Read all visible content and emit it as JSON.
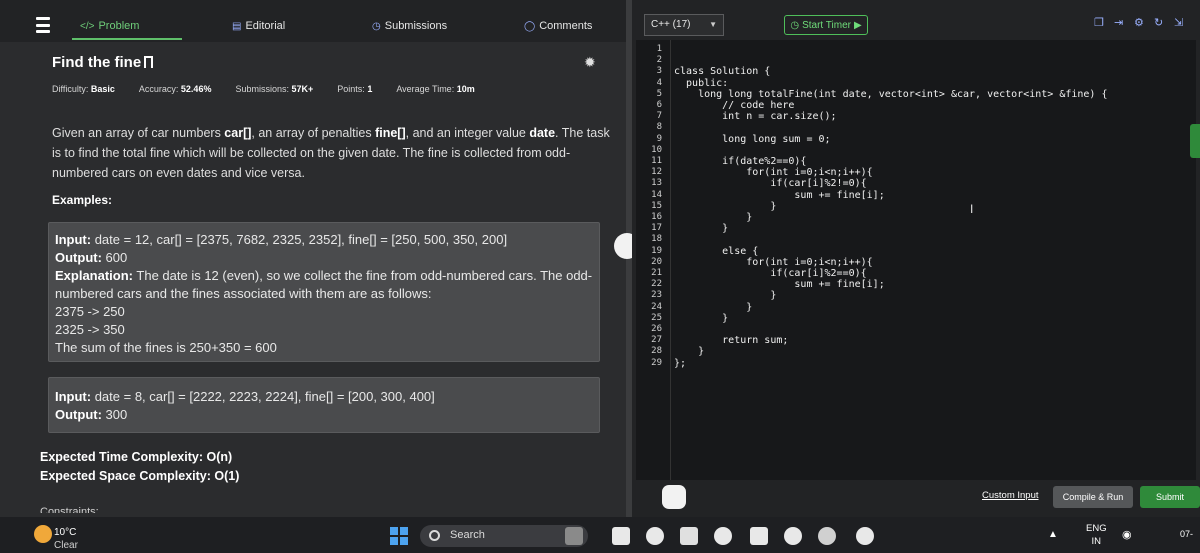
{
  "tabs": {
    "problem": "Problem",
    "editorial": "Editorial",
    "submissions": "Submissions",
    "comments": "Comments"
  },
  "problem": {
    "title": "Find the fine",
    "meta": {
      "difficulty_label": "Difficulty:",
      "difficulty": "Basic",
      "accuracy_label": "Accuracy:",
      "accuracy": "52.46%",
      "submissions_label": "Submissions:",
      "submissions": "57K+",
      "points_label": "Points:",
      "points": "1",
      "avg_time_label": "Average Time:",
      "avg_time": "10m"
    },
    "statement": {
      "p1": "Given an array of car numbers ",
      "b1": "car[]",
      "p2": ", an array of penalties ",
      "b2": "fine[]",
      "p3": ", and an integer value ",
      "b3": "date",
      "p4": ". The task is to find the total fine which will be collected on the given date. The fine is collected from odd-numbered cars on even dates and vice versa."
    },
    "examples_heading": "Examples:",
    "example1": {
      "input_label": "Input:",
      "input": " date = 12, car[] = [2375, 7682, 2325, 2352], fine[] = [250, 500, 350, 200]",
      "output_label": "Output:",
      "output": " 600",
      "explanation_label": "Explanation:",
      "explanation": " The date is 12 (even), so we collect the fine from odd-numbered cars. The odd-numbered cars and the fines associated with them are as follows:",
      "line1": "2375 -> 250",
      "line2": "2325 -> 350",
      "line3": "The sum of the fines is 250+350 = 600"
    },
    "example2": {
      "input_label": "Input:",
      "input": " date = 8, car[] = [2222, 2223, 2224], fine[] = [200, 300, 400]",
      "output_label": "Output:",
      "output": " 300"
    },
    "time_complexity_label": "Expected Time Complexity:",
    "time_complexity": " O(n)",
    "space_complexity_label": "Expected Space Complexity:",
    "space_complexity": " O(1)",
    "constraints_label": "Constraints:"
  },
  "editor": {
    "language": "C++ (17)",
    "timer_label": "Start Timer",
    "line_numbers": "1\n2\n3\n4\n5\n6\n7\n8\n9\n10\n11\n12\n13\n14\n15\n16\n17\n18\n19\n20\n21\n22\n23\n24\n25\n26\n27\n28\n29",
    "code": "\n\nclass Solution {\n  public:\n    long long totalFine(int date, vector<int> &car, vector<int> &fine) {\n        // code here\n        int n = car.size();\n\n        long long sum = 0;\n\n        if(date%2==0){\n            for(int i=0;i<n;i++){\n                if(car[i]%2!=0){\n                    sum += fine[i];\n                }\n            }\n        }\n\n        else {\n            for(int i=0;i<n;i++){\n                if(car[i]%2==0){\n                    sum += fine[i];\n                }\n            }\n        }\n\n        return sum;\n    }\n};",
    "custom_input": "Custom Input",
    "compile_run": "Compile & Run",
    "submit": "Submit"
  },
  "taskbar": {
    "temp": "10°C",
    "weather": "Clear",
    "search": "Search",
    "lang_top": "ENG",
    "lang_bottom": "IN",
    "time_fragment": "07-"
  }
}
